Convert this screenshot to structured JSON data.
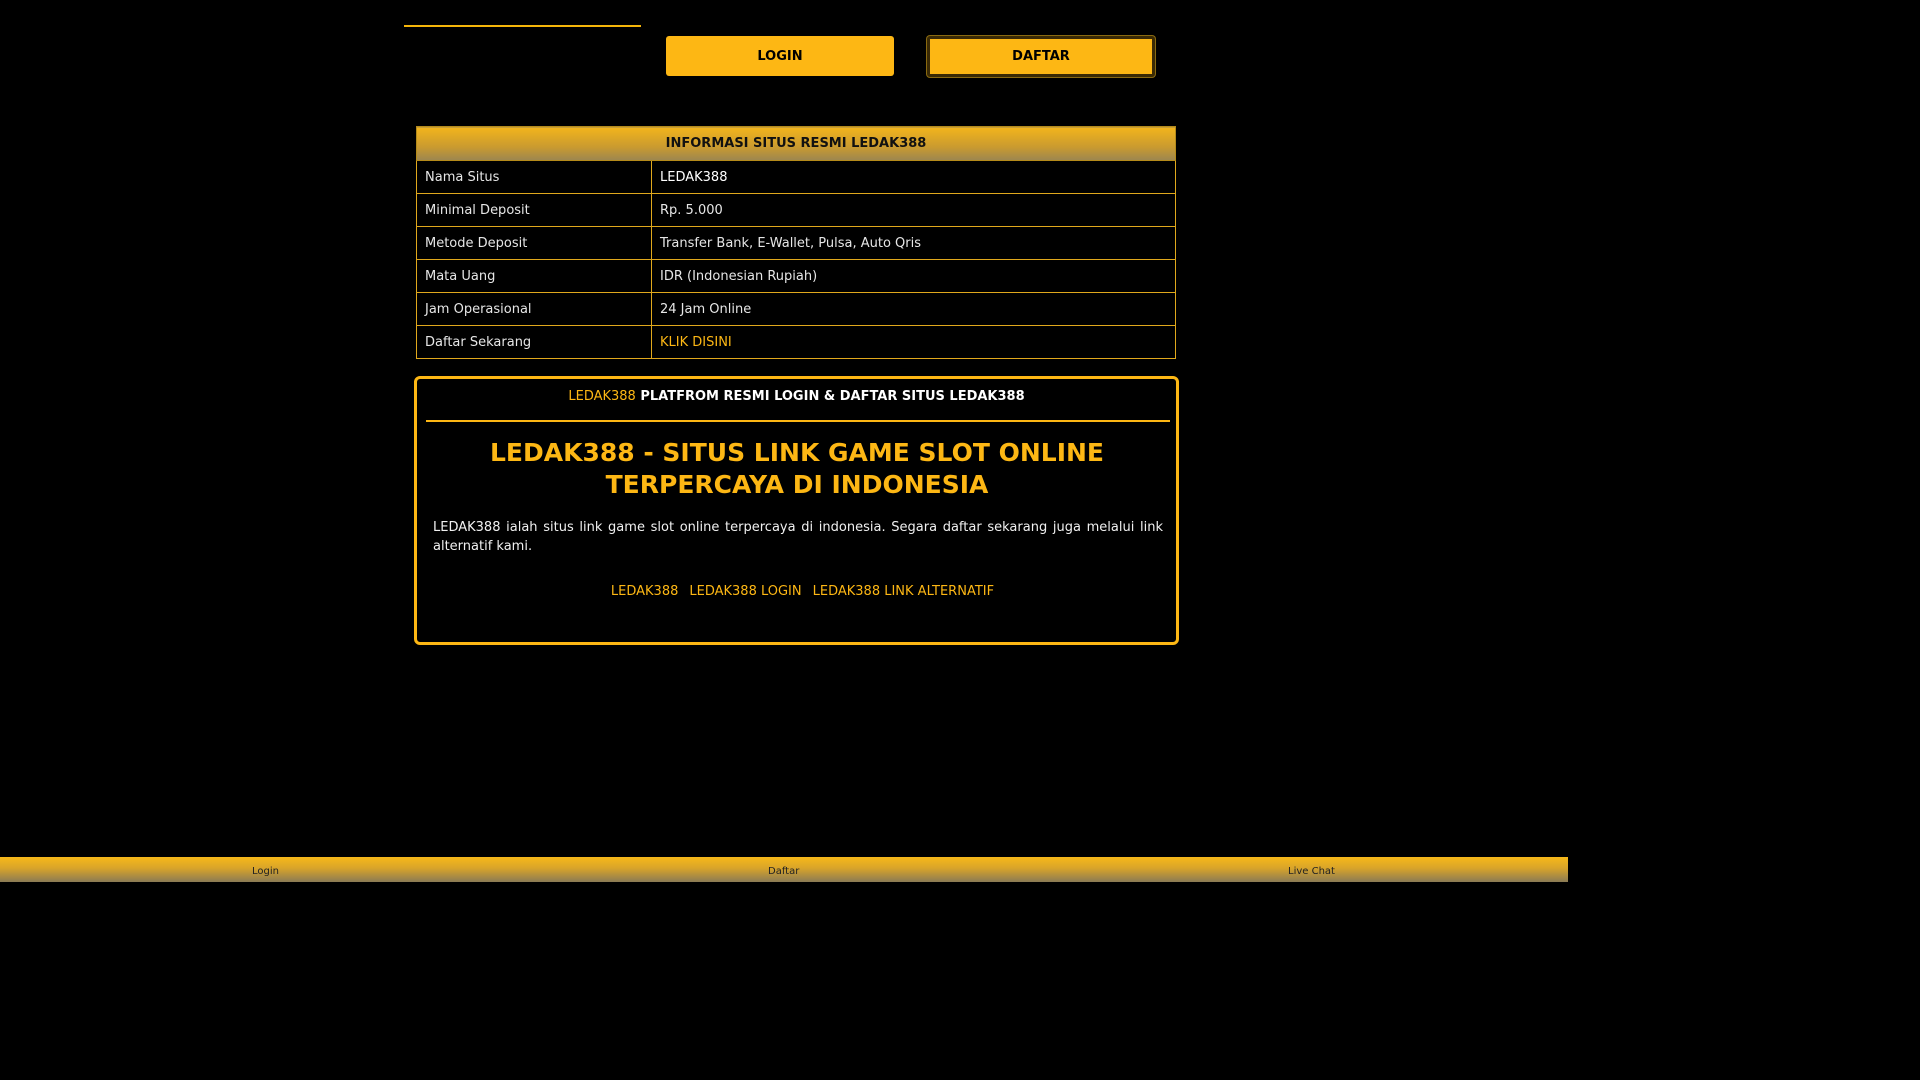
{
  "header": {
    "login_label": "LOGIN",
    "daftar_label": "DAFTAR"
  },
  "info_table": {
    "title": "INFORMASI SITUS RESMI LEDAK388",
    "rows": [
      {
        "key": "Nama Situs",
        "value": "LEDAK388"
      },
      {
        "key": "Minimal Deposit",
        "value": "Rp. 5.000"
      },
      {
        "key": "Metode Deposit",
        "value": "Transfer Bank, E-Wallet, Pulsa, Auto Qris"
      },
      {
        "key": "Mata Uang",
        "value": "IDR (Indonesian Rupiah)"
      },
      {
        "key": "Jam Operasional",
        "value": "24 Jam Online"
      },
      {
        "key": "Daftar Sekarang",
        "value": "KLIK DISINI"
      }
    ]
  },
  "content": {
    "tagline_brand": "LEDAK388",
    "tagline_text": "PLATFROM RESMI LOGIN & DAFTAR SITUS LEDAK388",
    "headline": "LEDAK388 - SITUS LINK GAME SLOT ONLINE TERPERCAYA DI INDONESIA",
    "description": "LEDAK388 ialah situs link game slot online terpercaya di indonesia. Segara daftar sekarang juga melalui link alternatif kami.",
    "links": [
      "LEDAK388",
      "LEDAK388 LOGIN",
      "LEDAK388 LINK ALTERNATIF"
    ]
  },
  "bottom_nav": {
    "login": "Login",
    "daftar": "Daftar",
    "live_chat": "Live Chat"
  },
  "colors": {
    "accent": "#fdb714",
    "background": "#000000"
  }
}
